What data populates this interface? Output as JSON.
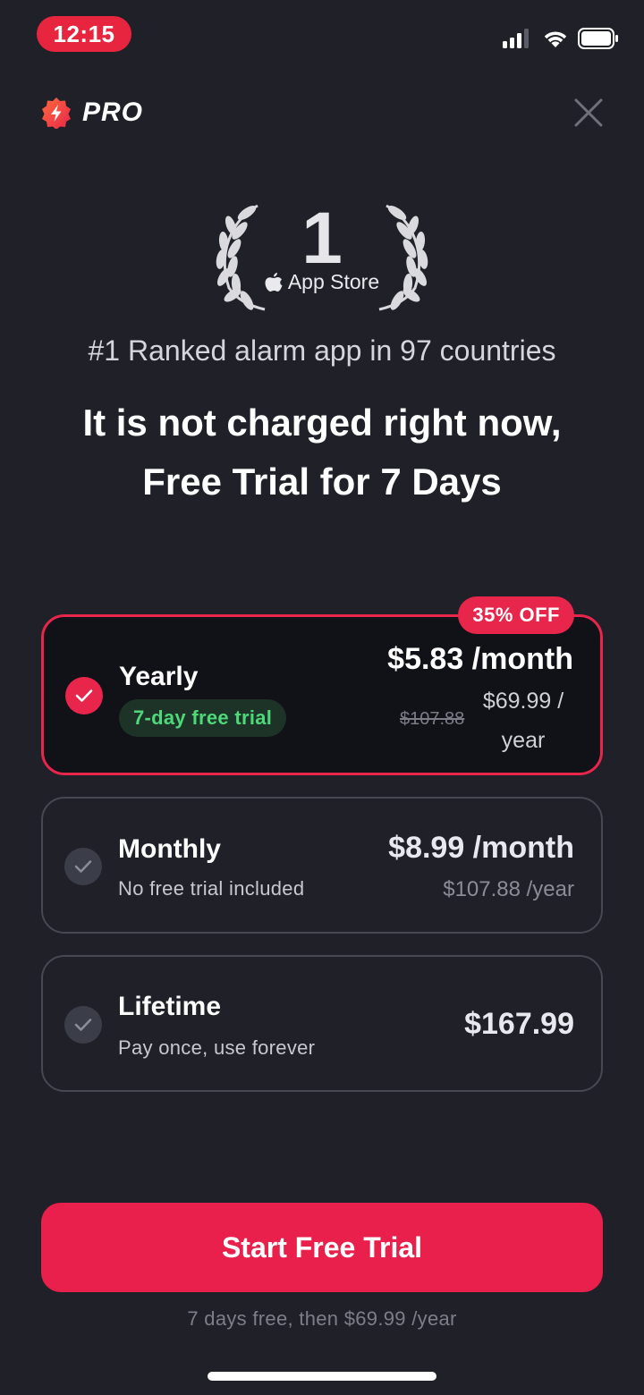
{
  "status_bar": {
    "time": "12:15"
  },
  "header": {
    "brand": "PRO"
  },
  "award": {
    "rank": "1",
    "store": "App Store"
  },
  "ranked_text": "#1 Ranked alarm app in 97 countries",
  "headline": {
    "line1": "It is not charged right now,",
    "line2": "Free Trial for 7 Days"
  },
  "plans": [
    {
      "name": "Yearly",
      "badge": "7-day free trial",
      "price_main": "$5.83 /month",
      "old_price": "$107.88",
      "price_year_line1": "$69.99 /",
      "price_year_line2": "year",
      "discount": "35% OFF",
      "selected": true
    },
    {
      "name": "Monthly",
      "subtitle": "No free trial included",
      "price_main": "$8.99 /month",
      "price_sub": "$107.88 /year",
      "selected": false
    },
    {
      "name": "Lifetime",
      "subtitle": "Pay once, use forever",
      "price_main": "$167.99",
      "selected": false
    }
  ],
  "cta": {
    "label": "Start Free Trial"
  },
  "footnote": "7 days free, then $69.99 /year",
  "colors": {
    "accent": "#e8254a",
    "background": "#1f2028",
    "trial_green": "#4ed87a"
  }
}
